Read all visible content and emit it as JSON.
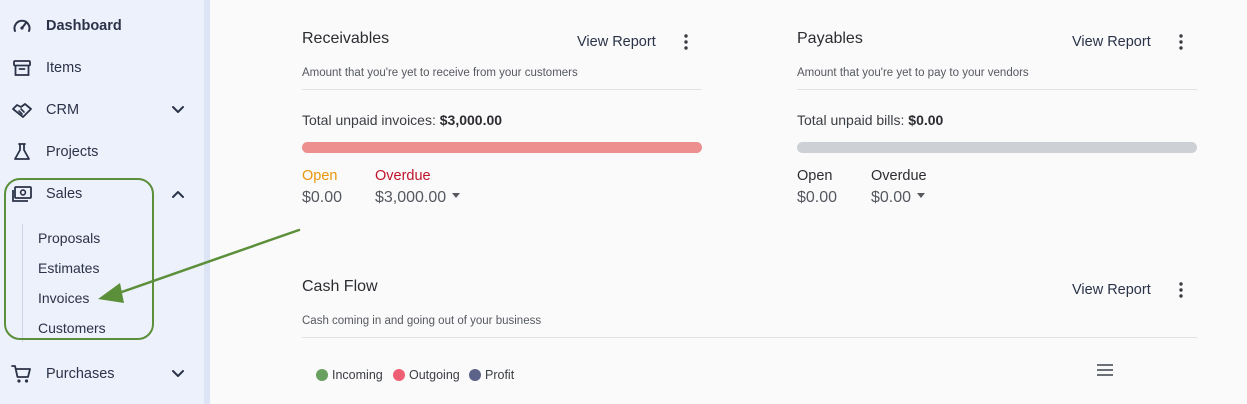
{
  "sidebar": {
    "items": [
      {
        "label": "Dashboard",
        "icon": "gauge-icon"
      },
      {
        "label": "Items",
        "icon": "archive-box-icon"
      },
      {
        "label": "CRM",
        "icon": "handshake-icon"
      },
      {
        "label": "Projects",
        "icon": "flask-icon"
      },
      {
        "label": "Sales",
        "icon": "banknote-icon"
      },
      {
        "label": "Purchases",
        "icon": "cart-icon"
      }
    ],
    "sales_subitems": [
      "Proposals",
      "Estimates",
      "Invoices",
      "Customers"
    ]
  },
  "receivables": {
    "title": "Receivables",
    "view_report": "View Report",
    "subtitle": "Amount that you're yet to receive from your customers",
    "total_label": "Total unpaid invoices:",
    "total_value": "$3,000.00",
    "overdue_fraction": 1.0,
    "open_label": "Open",
    "open_value": "$0.00",
    "overdue_label": "Overdue",
    "overdue_value": "$3,000.00"
  },
  "payables": {
    "title": "Payables",
    "view_report": "View Report",
    "subtitle": "Amount that you're yet to pay to your vendors",
    "total_label": "Total unpaid bills:",
    "total_value": "$0.00",
    "open_label": "Open",
    "open_value": "$0.00",
    "overdue_label": "Overdue",
    "overdue_value": "$0.00"
  },
  "cashflow": {
    "title": "Cash Flow",
    "view_report": "View Report",
    "subtitle": "Cash coming in and going out of your business",
    "legend": [
      {
        "label": "Incoming",
        "color": "#6aa05f"
      },
      {
        "label": "Outgoing",
        "color": "#ef5f74"
      },
      {
        "label": "Profit",
        "color": "#5c6389"
      }
    ]
  },
  "colors": {
    "overdue_bar": "#ee8f8f",
    "empty_bar": "#cdd0d5",
    "open_label": "#e8960c",
    "overdue_label": "#c0142b",
    "annotation_green": "#5b8f3a"
  }
}
